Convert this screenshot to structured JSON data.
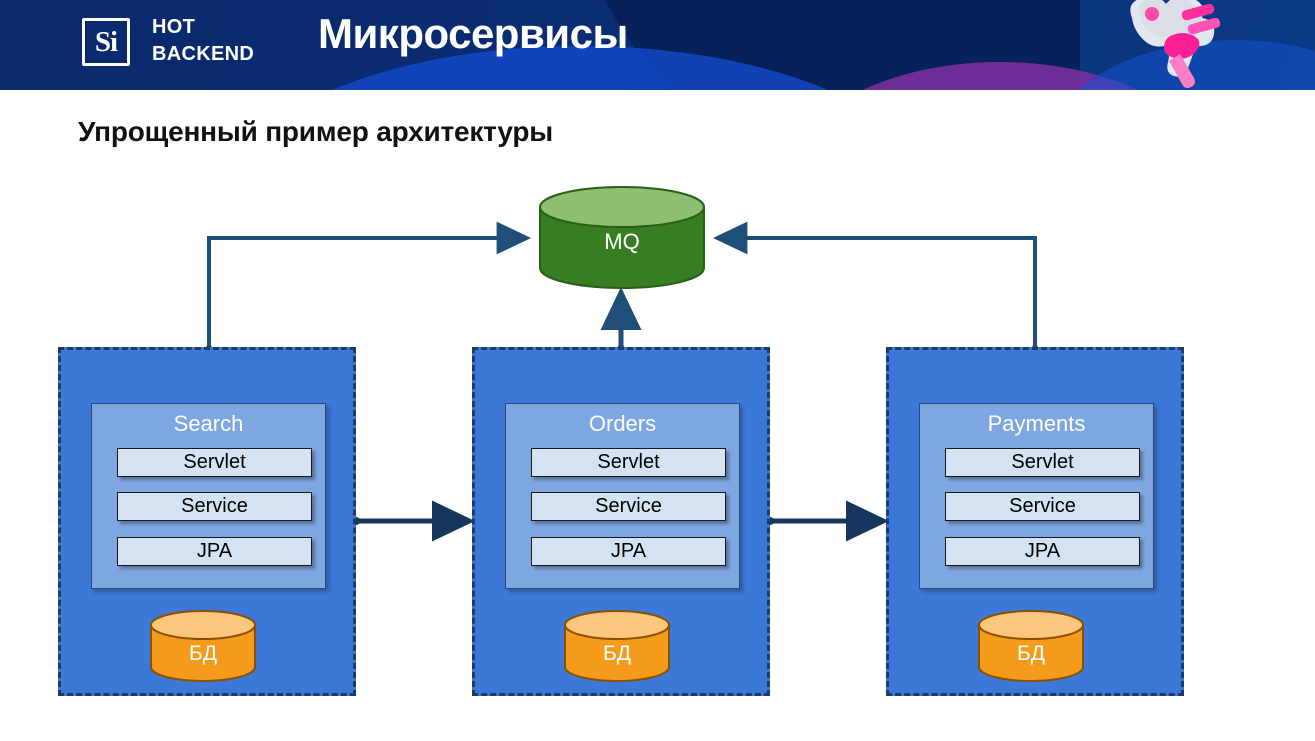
{
  "header": {
    "logo_mark": "Si",
    "logo_line1": "HOT",
    "logo_line2": "BACKEND",
    "title": "Микросервисы",
    "bg_color": "#0a2b6e",
    "accent_blue": "#1249c4",
    "accent_purple": "#7b2f9e",
    "accent_pink": "#ff2fa0"
  },
  "slide": {
    "subtitle": "Упрощенный пример архитектуры"
  },
  "diagram": {
    "broker": {
      "label": "MQ",
      "shape": "cylinder",
      "fill": "#377d22",
      "top_fill": "#8cbf6f",
      "text_color": "#ffffff"
    },
    "container_fill": "#3c78d8",
    "container_border": "#1c3c64",
    "panel_fill": "#7ea6e0",
    "layer_fill": "#d4e2f2",
    "db_fill": "#f59b1c",
    "db_top_fill": "#fbc77d",
    "connector_color": "#1f4e79",
    "connector_dark": "#17365d",
    "services": [
      {
        "name": "Search",
        "layers": [
          "Servlet",
          "Service",
          "JPA"
        ],
        "database": "БД"
      },
      {
        "name": "Orders",
        "layers": [
          "Servlet",
          "Service",
          "JPA"
        ],
        "database": "БД"
      },
      {
        "name": "Payments",
        "layers": [
          "Servlet",
          "Service",
          "JPA"
        ],
        "database": "БД"
      }
    ],
    "connections": [
      {
        "from": "Search",
        "to": "MQ",
        "style": "elbow",
        "arrows": "both"
      },
      {
        "from": "Orders",
        "to": "MQ",
        "style": "vertical",
        "arrows": "both"
      },
      {
        "from": "Payments",
        "to": "MQ",
        "style": "elbow",
        "arrows": "both"
      },
      {
        "from": "Search",
        "to": "Orders",
        "style": "horizontal",
        "arrows": "both"
      },
      {
        "from": "Orders",
        "to": "Payments",
        "style": "horizontal",
        "arrows": "both"
      }
    ]
  }
}
